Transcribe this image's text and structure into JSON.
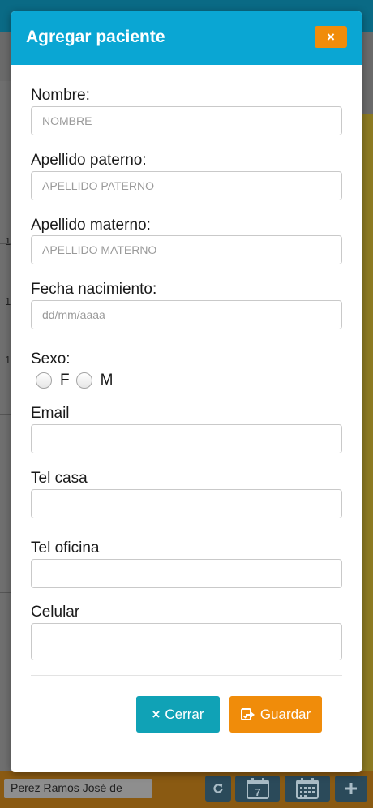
{
  "modal": {
    "title": "Agregar paciente",
    "close_icon": "×"
  },
  "form": {
    "nombre": {
      "label": "Nombre:",
      "placeholder": "NOMBRE",
      "value": ""
    },
    "apellido_paterno": {
      "label": "Apellido paterno:",
      "placeholder": "APELLIDO PATERNO",
      "value": ""
    },
    "apellido_materno": {
      "label": "Apellido materno:",
      "placeholder": "APELLIDO MATERNO",
      "value": ""
    },
    "fecha_nacimiento": {
      "label": "Fecha nacimiento:",
      "placeholder": "dd/mm/aaaa",
      "value": ""
    },
    "sexo": {
      "label": "Sexo:",
      "options": [
        "F",
        "M"
      ]
    },
    "email": {
      "label": "Email",
      "value": ""
    },
    "tel_casa": {
      "label": "Tel casa",
      "value": ""
    },
    "tel_oficina": {
      "label": "Tel oficina",
      "value": ""
    },
    "celular": {
      "label": "Celular",
      "value": ""
    }
  },
  "actions": {
    "cerrar": {
      "label": "Cerrar",
      "icon": "×"
    },
    "guardar": {
      "label": "Guardar",
      "icon": "share-check-icon"
    }
  },
  "background": {
    "patient_name": "Perez Ramos José de",
    "calendar_day": "7",
    "left_numbers": [
      "1",
      "1",
      "1"
    ]
  },
  "colors": {
    "header": "#0aa6d3",
    "close": "#f08c0a",
    "cerrar_button": "#10a2b6",
    "guardar_button": "#f08c0a"
  }
}
